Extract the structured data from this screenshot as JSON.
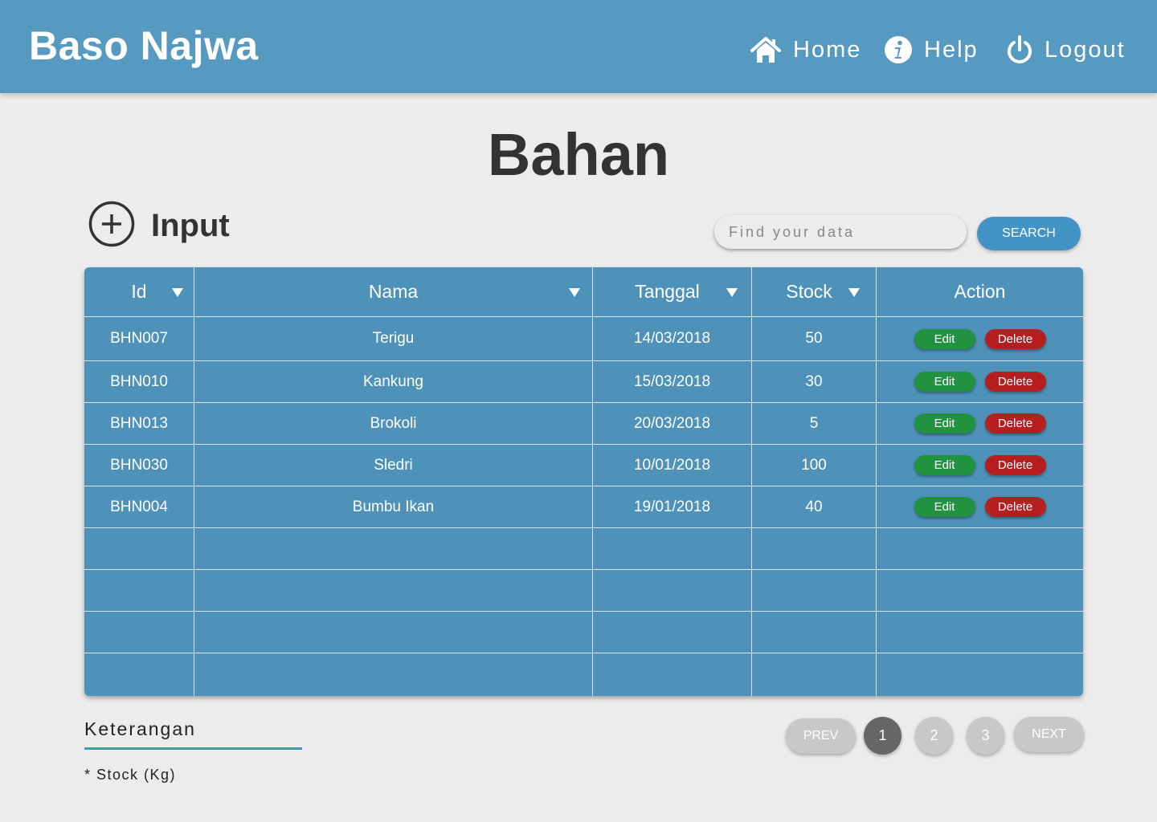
{
  "header": {
    "brand": "Baso Najwa",
    "nav": {
      "home": "Home",
      "help": "Help",
      "logout": "Logout"
    }
  },
  "page": {
    "title": "Bahan",
    "input_label": "Input"
  },
  "search": {
    "placeholder": "Find your data",
    "button": "SEARCH"
  },
  "table": {
    "columns": [
      "Id",
      "Nama",
      "Tanggal",
      "Stock",
      "Action"
    ],
    "rows": [
      {
        "id": "BHN007",
        "nama": "Terigu",
        "tanggal": "14/03/2018",
        "stock": "50"
      },
      {
        "id": "BHN010",
        "nama": "Kankung",
        "tanggal": "15/03/2018",
        "stock": "30"
      },
      {
        "id": "BHN013",
        "nama": "Brokoli",
        "tanggal": "20/03/2018",
        "stock": "5"
      },
      {
        "id": "BHN030",
        "nama": "Sledri",
        "tanggal": "10/01/2018",
        "stock": "100"
      },
      {
        "id": "BHN004",
        "nama": "Bumbu Ikan",
        "tanggal": "19/01/2018",
        "stock": "40"
      }
    ],
    "action_labels": {
      "edit": "Edit",
      "delete": "Delete"
    }
  },
  "keterangan": {
    "title": "Keterangan",
    "note": "* Stock (Kg)"
  },
  "pagination": {
    "prev": "PREV",
    "pages": [
      "1",
      "2",
      "3"
    ],
    "next": "NEXT",
    "current": "1"
  },
  "colors": {
    "header": "#5699c1",
    "table": "#4e91b9",
    "accent": "#4294c7",
    "edit": "#21923f",
    "delete": "#b51f1f"
  }
}
